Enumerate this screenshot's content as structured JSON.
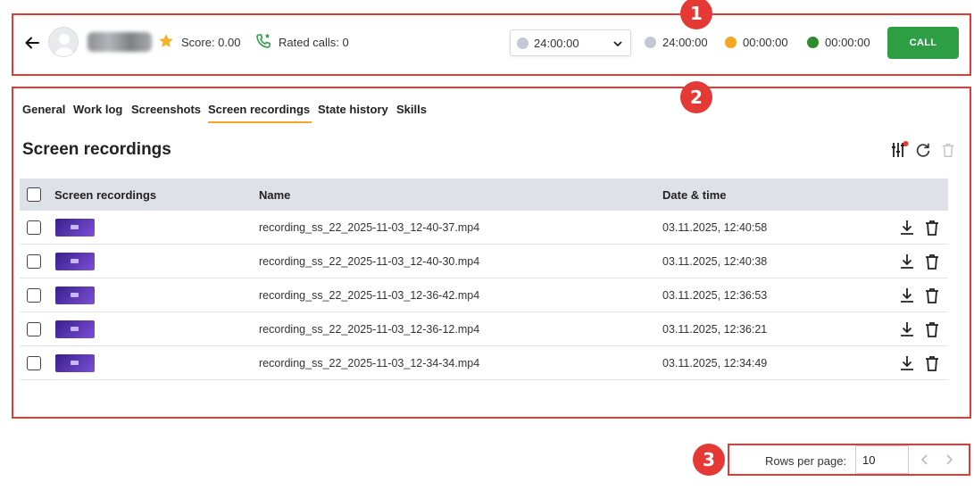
{
  "header": {
    "score": "Score: 0.00",
    "rated_calls": "Rated calls: 0",
    "selected_time": "24:00:00",
    "timers": [
      {
        "value": "24:00:00",
        "color": "#c5c8d3"
      },
      {
        "value": "00:00:00",
        "color": "#f5a623"
      },
      {
        "value": "00:00:00",
        "color": "#2e8b2e"
      }
    ],
    "call_label": "CALL"
  },
  "tabs": [
    "General",
    "Work log",
    "Screenshots",
    "Screen recordings",
    "State history",
    "Skills"
  ],
  "active_tab": "Screen recordings",
  "section_title": "Screen recordings",
  "table": {
    "columns": [
      "Screen recordings",
      "Name",
      "Date & time"
    ],
    "rows": [
      {
        "name": "recording_ss_22_2025-11-03_12-40-37.mp4",
        "datetime": "03.11.2025, 12:40:58"
      },
      {
        "name": "recording_ss_22_2025-11-03_12-40-30.mp4",
        "datetime": "03.11.2025, 12:40:38"
      },
      {
        "name": "recording_ss_22_2025-11-03_12-36-42.mp4",
        "datetime": "03.11.2025, 12:36:53"
      },
      {
        "name": "recording_ss_22_2025-11-03_12-36-12.mp4",
        "datetime": "03.11.2025, 12:36:21"
      },
      {
        "name": "recording_ss_22_2025-11-03_12-34-34.mp4",
        "datetime": "03.11.2025, 12:34:49"
      }
    ]
  },
  "pagination": {
    "rows_per_page_label": "Rows per page:",
    "rows_per_page": "10"
  },
  "annotations": [
    "1",
    "2",
    "3"
  ],
  "colors": {
    "annotation_red": "#e53935",
    "call_green": "#2e9e45",
    "tab_accent": "#f5a623",
    "table_header": "#dfe1e8"
  }
}
